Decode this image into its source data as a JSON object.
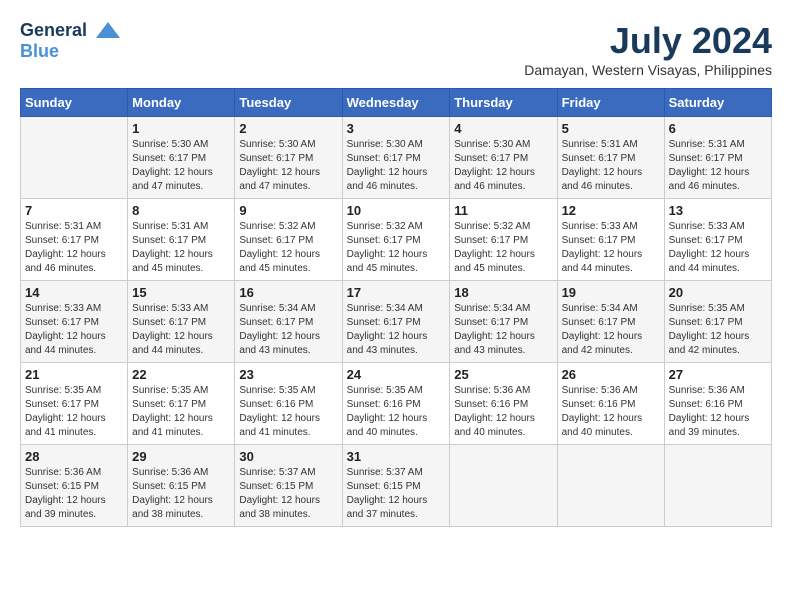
{
  "logo": {
    "line1": "General",
    "line2": "Blue"
  },
  "title": "July 2024",
  "location": "Damayan, Western Visayas, Philippines",
  "headers": [
    "Sunday",
    "Monday",
    "Tuesday",
    "Wednesday",
    "Thursday",
    "Friday",
    "Saturday"
  ],
  "weeks": [
    [
      {
        "day": "",
        "sunrise": "",
        "sunset": "",
        "daylight": ""
      },
      {
        "day": "1",
        "sunrise": "Sunrise: 5:30 AM",
        "sunset": "Sunset: 6:17 PM",
        "daylight": "Daylight: 12 hours and 47 minutes."
      },
      {
        "day": "2",
        "sunrise": "Sunrise: 5:30 AM",
        "sunset": "Sunset: 6:17 PM",
        "daylight": "Daylight: 12 hours and 47 minutes."
      },
      {
        "day": "3",
        "sunrise": "Sunrise: 5:30 AM",
        "sunset": "Sunset: 6:17 PM",
        "daylight": "Daylight: 12 hours and 46 minutes."
      },
      {
        "day": "4",
        "sunrise": "Sunrise: 5:30 AM",
        "sunset": "Sunset: 6:17 PM",
        "daylight": "Daylight: 12 hours and 46 minutes."
      },
      {
        "day": "5",
        "sunrise": "Sunrise: 5:31 AM",
        "sunset": "Sunset: 6:17 PM",
        "daylight": "Daylight: 12 hours and 46 minutes."
      },
      {
        "day": "6",
        "sunrise": "Sunrise: 5:31 AM",
        "sunset": "Sunset: 6:17 PM",
        "daylight": "Daylight: 12 hours and 46 minutes."
      }
    ],
    [
      {
        "day": "7",
        "sunrise": "Sunrise: 5:31 AM",
        "sunset": "Sunset: 6:17 PM",
        "daylight": "Daylight: 12 hours and 46 minutes."
      },
      {
        "day": "8",
        "sunrise": "Sunrise: 5:31 AM",
        "sunset": "Sunset: 6:17 PM",
        "daylight": "Daylight: 12 hours and 45 minutes."
      },
      {
        "day": "9",
        "sunrise": "Sunrise: 5:32 AM",
        "sunset": "Sunset: 6:17 PM",
        "daylight": "Daylight: 12 hours and 45 minutes."
      },
      {
        "day": "10",
        "sunrise": "Sunrise: 5:32 AM",
        "sunset": "Sunset: 6:17 PM",
        "daylight": "Daylight: 12 hours and 45 minutes."
      },
      {
        "day": "11",
        "sunrise": "Sunrise: 5:32 AM",
        "sunset": "Sunset: 6:17 PM",
        "daylight": "Daylight: 12 hours and 45 minutes."
      },
      {
        "day": "12",
        "sunrise": "Sunrise: 5:33 AM",
        "sunset": "Sunset: 6:17 PM",
        "daylight": "Daylight: 12 hours and 44 minutes."
      },
      {
        "day": "13",
        "sunrise": "Sunrise: 5:33 AM",
        "sunset": "Sunset: 6:17 PM",
        "daylight": "Daylight: 12 hours and 44 minutes."
      }
    ],
    [
      {
        "day": "14",
        "sunrise": "Sunrise: 5:33 AM",
        "sunset": "Sunset: 6:17 PM",
        "daylight": "Daylight: 12 hours and 44 minutes."
      },
      {
        "day": "15",
        "sunrise": "Sunrise: 5:33 AM",
        "sunset": "Sunset: 6:17 PM",
        "daylight": "Daylight: 12 hours and 44 minutes."
      },
      {
        "day": "16",
        "sunrise": "Sunrise: 5:34 AM",
        "sunset": "Sunset: 6:17 PM",
        "daylight": "Daylight: 12 hours and 43 minutes."
      },
      {
        "day": "17",
        "sunrise": "Sunrise: 5:34 AM",
        "sunset": "Sunset: 6:17 PM",
        "daylight": "Daylight: 12 hours and 43 minutes."
      },
      {
        "day": "18",
        "sunrise": "Sunrise: 5:34 AM",
        "sunset": "Sunset: 6:17 PM",
        "daylight": "Daylight: 12 hours and 43 minutes."
      },
      {
        "day": "19",
        "sunrise": "Sunrise: 5:34 AM",
        "sunset": "Sunset: 6:17 PM",
        "daylight": "Daylight: 12 hours and 42 minutes."
      },
      {
        "day": "20",
        "sunrise": "Sunrise: 5:35 AM",
        "sunset": "Sunset: 6:17 PM",
        "daylight": "Daylight: 12 hours and 42 minutes."
      }
    ],
    [
      {
        "day": "21",
        "sunrise": "Sunrise: 5:35 AM",
        "sunset": "Sunset: 6:17 PM",
        "daylight": "Daylight: 12 hours and 41 minutes."
      },
      {
        "day": "22",
        "sunrise": "Sunrise: 5:35 AM",
        "sunset": "Sunset: 6:17 PM",
        "daylight": "Daylight: 12 hours and 41 minutes."
      },
      {
        "day": "23",
        "sunrise": "Sunrise: 5:35 AM",
        "sunset": "Sunset: 6:16 PM",
        "daylight": "Daylight: 12 hours and 41 minutes."
      },
      {
        "day": "24",
        "sunrise": "Sunrise: 5:35 AM",
        "sunset": "Sunset: 6:16 PM",
        "daylight": "Daylight: 12 hours and 40 minutes."
      },
      {
        "day": "25",
        "sunrise": "Sunrise: 5:36 AM",
        "sunset": "Sunset: 6:16 PM",
        "daylight": "Daylight: 12 hours and 40 minutes."
      },
      {
        "day": "26",
        "sunrise": "Sunrise: 5:36 AM",
        "sunset": "Sunset: 6:16 PM",
        "daylight": "Daylight: 12 hours and 40 minutes."
      },
      {
        "day": "27",
        "sunrise": "Sunrise: 5:36 AM",
        "sunset": "Sunset: 6:16 PM",
        "daylight": "Daylight: 12 hours and 39 minutes."
      }
    ],
    [
      {
        "day": "28",
        "sunrise": "Sunrise: 5:36 AM",
        "sunset": "Sunset: 6:15 PM",
        "daylight": "Daylight: 12 hours and 39 minutes."
      },
      {
        "day": "29",
        "sunrise": "Sunrise: 5:36 AM",
        "sunset": "Sunset: 6:15 PM",
        "daylight": "Daylight: 12 hours and 38 minutes."
      },
      {
        "day": "30",
        "sunrise": "Sunrise: 5:37 AM",
        "sunset": "Sunset: 6:15 PM",
        "daylight": "Daylight: 12 hours and 38 minutes."
      },
      {
        "day": "31",
        "sunrise": "Sunrise: 5:37 AM",
        "sunset": "Sunset: 6:15 PM",
        "daylight": "Daylight: 12 hours and 37 minutes."
      },
      {
        "day": "",
        "sunrise": "",
        "sunset": "",
        "daylight": ""
      },
      {
        "day": "",
        "sunrise": "",
        "sunset": "",
        "daylight": ""
      },
      {
        "day": "",
        "sunrise": "",
        "sunset": "",
        "daylight": ""
      }
    ]
  ]
}
